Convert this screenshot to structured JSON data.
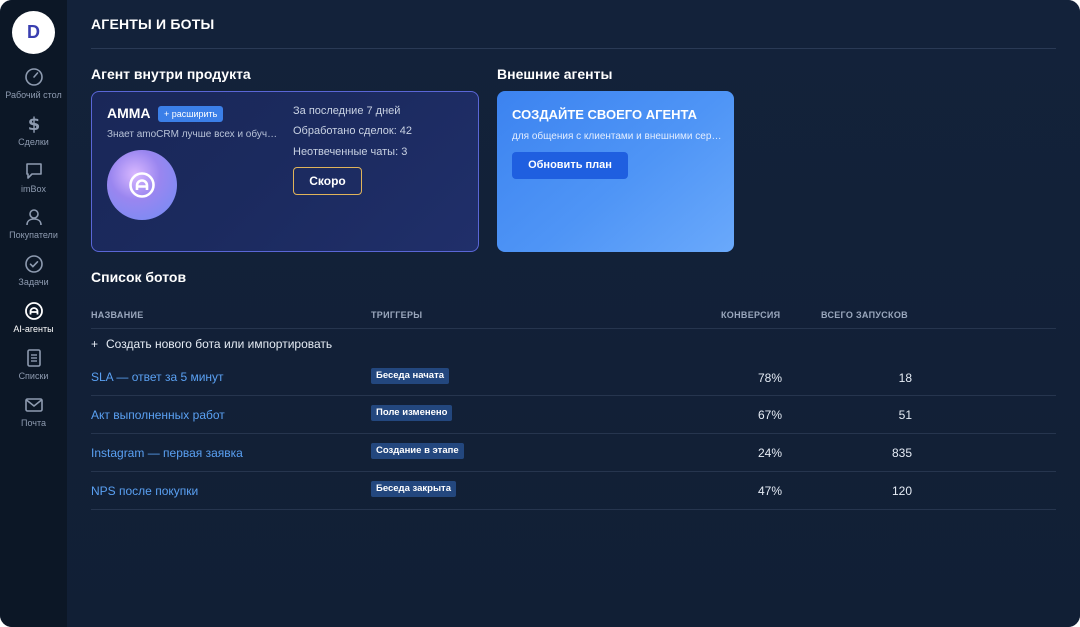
{
  "app": {
    "logo_letter": "D"
  },
  "sidebar": {
    "items": [
      {
        "label": "Рабочий стол",
        "icon": "gauge-icon"
      },
      {
        "label": "Сделки",
        "icon": "dollar-icon"
      },
      {
        "label": "imBox",
        "icon": "chat-icon"
      },
      {
        "label": "Покупатели",
        "icon": "user-icon"
      },
      {
        "label": "Задачи",
        "icon": "check-circle-icon"
      },
      {
        "label": "AI-агенты",
        "icon": "ai-agent-icon",
        "active": true
      },
      {
        "label": "Списки",
        "icon": "list-doc-icon"
      },
      {
        "label": "Почта",
        "icon": "mail-icon"
      }
    ]
  },
  "header": {
    "title": "АГЕНТЫ И БОТЫ"
  },
  "product_agent": {
    "section_title": "Агент внутри продукта",
    "name": "AMMA",
    "expand_label": "+ расширить",
    "description": "Знает amoCRM лучше всех и обучает вас",
    "stats": {
      "period": "За последние 7 дней",
      "deals": "Обработано сделок: 42",
      "chats": "Неотвеченные чаты: 3"
    },
    "button": "Скоро"
  },
  "external_agents": {
    "section_title": "Внешние агенты",
    "card_title": "СОЗДАЙТЕ СВОЕГО АГЕНТА",
    "card_subtitle": "для общения с клиентами и внешними сервисами",
    "button": "Обновить план"
  },
  "bots": {
    "section_title": "Список ботов",
    "columns": {
      "name": "НАЗВАНИЕ",
      "triggers": "ТРИГГЕРЫ",
      "conversion": "КОНВЕРСИЯ",
      "runs": "ВСЕГО ЗАПУСКОВ"
    },
    "create_label": "Создать нового бота или импортировать",
    "create_plus": "+",
    "rows": [
      {
        "name": "SLA — ответ за 5 минут",
        "trigger": "Беседа начата",
        "conversion": "78%",
        "runs": "18"
      },
      {
        "name": "Акт выполненных работ",
        "trigger": "Поле изменено",
        "conversion": "67%",
        "runs": "51"
      },
      {
        "name": "Instagram — первая заявка",
        "trigger": "Создание в этапе",
        "conversion": "24%",
        "runs": "835"
      },
      {
        "name": "NPS после покупки",
        "trigger": "Беседа закрыта",
        "conversion": "47%",
        "runs": "120"
      }
    ]
  },
  "colors": {
    "background": "#11213a",
    "sidebar": "#0c1726",
    "accent": "#3b7fe8",
    "link": "#5aa0f2",
    "soon_border": "#e0b45a"
  }
}
